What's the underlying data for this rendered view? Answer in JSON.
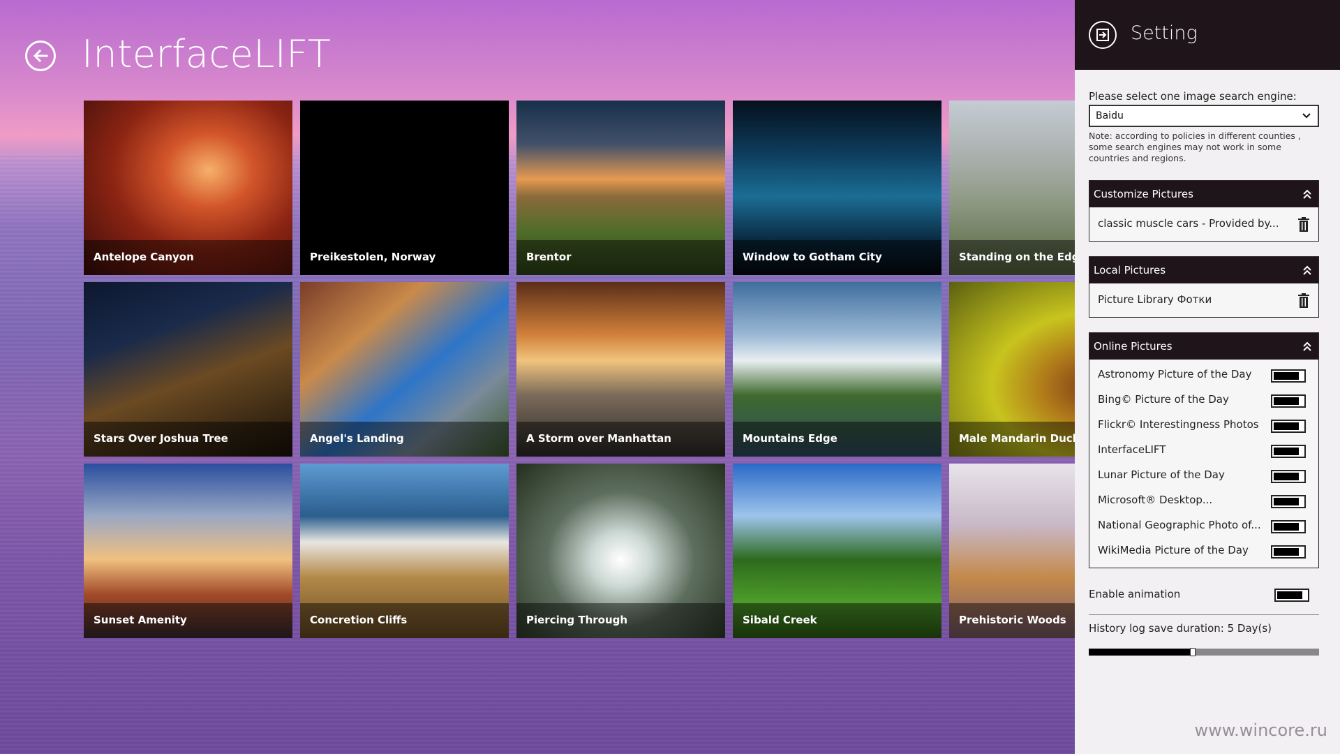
{
  "app": {
    "title": "InterfaceLIFT"
  },
  "tiles": [
    {
      "caption": "Antelope Canyon"
    },
    {
      "caption": "Preikestolen, Norway"
    },
    {
      "caption": "Brentor"
    },
    {
      "caption": "Window to Gotham City"
    },
    {
      "caption": "Standing on the Edge of Infinity"
    },
    {
      "caption": "Stars Over Joshua Tree"
    },
    {
      "caption": "Angel's Landing"
    },
    {
      "caption": "A Storm over Manhattan"
    },
    {
      "caption": "Mountains Edge"
    },
    {
      "caption": "Male Mandarin Duck"
    },
    {
      "caption": "Sunset Amenity"
    },
    {
      "caption": "Concretion Cliffs"
    },
    {
      "caption": "Piercing Through"
    },
    {
      "caption": "Sibald Creek"
    },
    {
      "caption": "Prehistoric Woods"
    }
  ],
  "settings": {
    "title": "Setting",
    "engine_prompt": "Please select one image search engine:",
    "engine_selected": "Baidu",
    "engine_note": "Note: according to policies in different counties , some search engines may not work in some countries and regions.",
    "customize": {
      "title": "Customize Pictures",
      "items": [
        {
          "label": "classic muscle cars  -  Provided by..."
        }
      ]
    },
    "local": {
      "title": "Local Pictures",
      "items": [
        {
          "label": "Picture Library  Фотки"
        }
      ]
    },
    "online": {
      "title": "Online Pictures",
      "items": [
        {
          "label": "Astronomy Picture of the Day",
          "on": true
        },
        {
          "label": "Bing© Picture of the Day",
          "on": true
        },
        {
          "label": "Flickr© Interestingness Photos",
          "on": true
        },
        {
          "label": "InterfaceLIFT",
          "on": true
        },
        {
          "label": "Lunar Picture of the Day",
          "on": true
        },
        {
          "label": "Microsoft® Desktop...",
          "on": true
        },
        {
          "label": "National Geographic Photo of...",
          "on": true
        },
        {
          "label": "WikiMedia Picture of the Day",
          "on": true
        }
      ]
    },
    "animation": {
      "label": "Enable animation",
      "on": true
    },
    "history": {
      "label": "History log save duration: 5 Day(s)",
      "value_fraction": 0.44
    }
  },
  "watermark": "www.wincore.ru"
}
